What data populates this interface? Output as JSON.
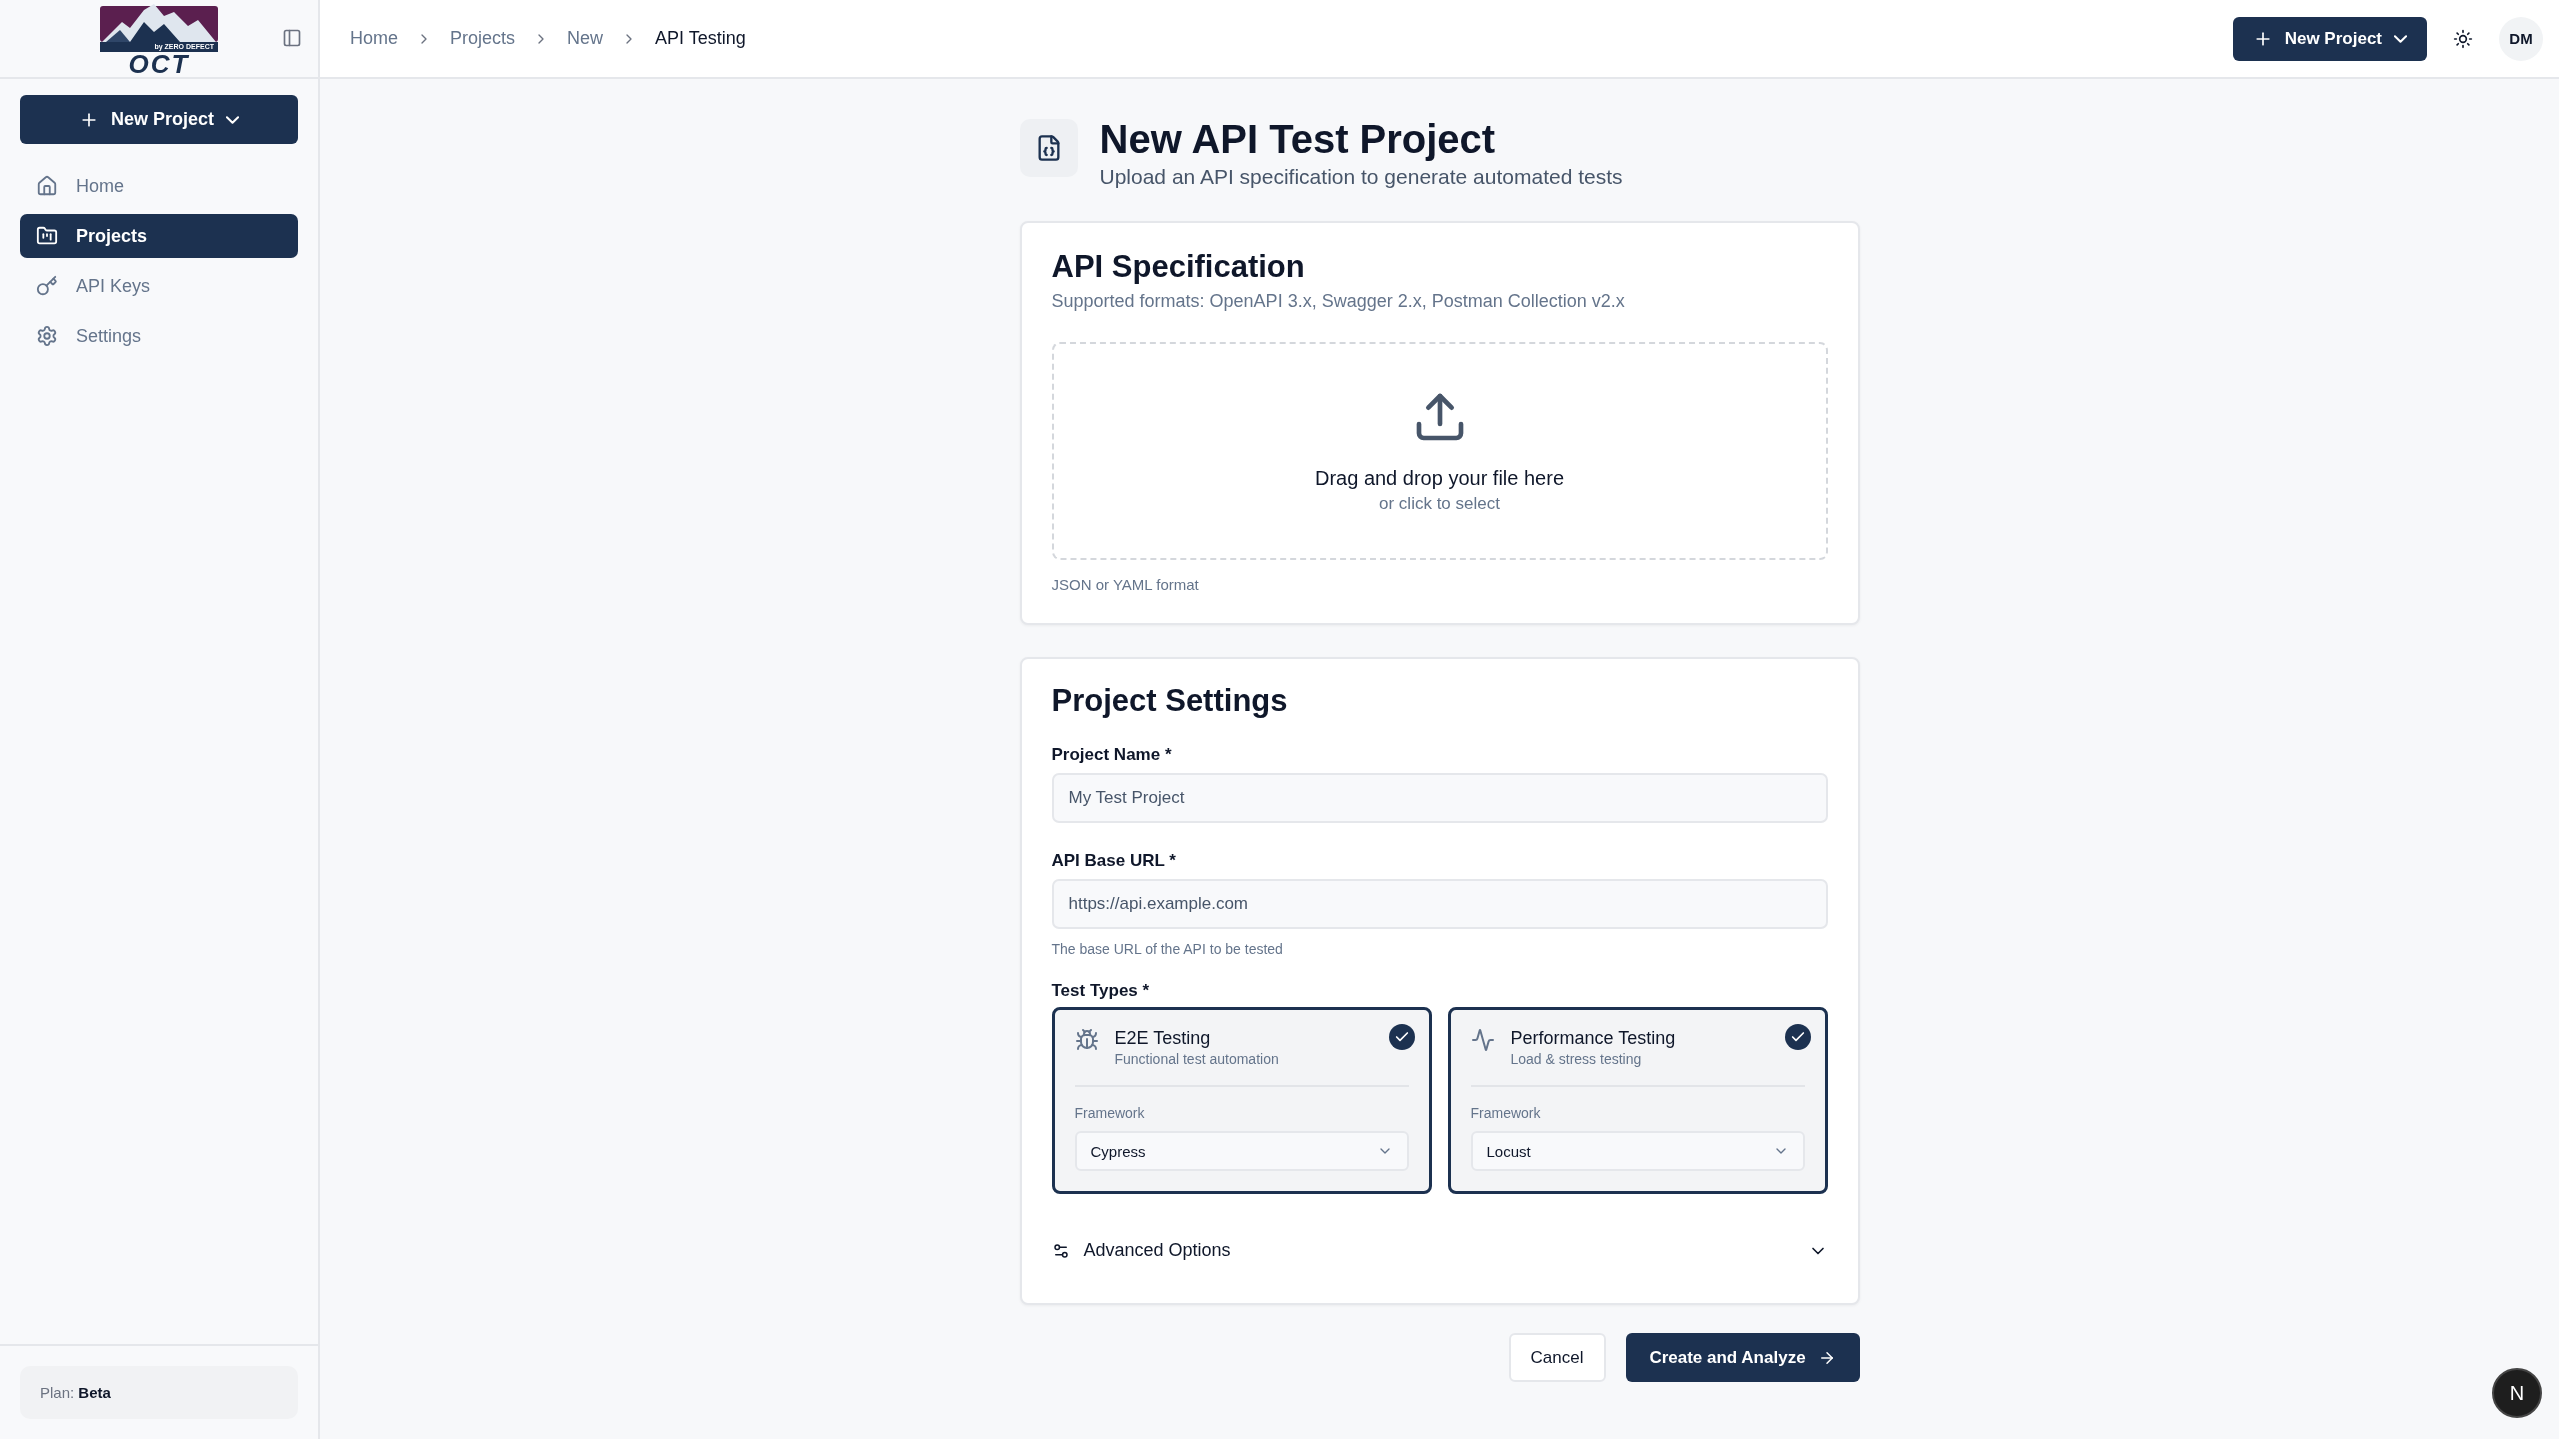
{
  "logo": {
    "tagline": "by ZERO DEFECT",
    "wordmark": "OCT"
  },
  "sidebar": {
    "new_project_button": "New Project",
    "items": [
      {
        "label": "Home",
        "selected": false
      },
      {
        "label": "Projects",
        "selected": true
      },
      {
        "label": "API Keys",
        "selected": false
      },
      {
        "label": "Settings",
        "selected": false
      }
    ],
    "plan": "Plan: **Beta**"
  },
  "breadcrumbs": [
    {
      "label": "Home",
      "current": false
    },
    {
      "label": "Projects",
      "current": false
    },
    {
      "label": "New",
      "current": false
    },
    {
      "label": "API Testing",
      "current": true
    }
  ],
  "header": {
    "new_project_button": "New Project",
    "avatar": "DM"
  },
  "page": {
    "title": "New API Test Project",
    "subtitle": "Upload an API specification to generate automated tests"
  },
  "api_spec": {
    "title": "API Specification",
    "formats": "Supported formats: OpenAPI 3.x, Swagger 2.x, Postman Collection v2.x",
    "dropzone": {
      "title": "Drag and drop your file here",
      "hint": "or click to select"
    },
    "note": "JSON or YAML format"
  },
  "settings": {
    "title": "Project Settings",
    "fields": [
      {
        "label": "Project Name *",
        "placeholder": "My Test Project"
      },
      {
        "label": "API Base URL *",
        "placeholder": "https://api.example.com",
        "help": "The base URL of the API to be tested"
      }
    ],
    "test_types_label": "Test Types *",
    "test_types": [
      {
        "kind": "e2e",
        "title": "E2E Testing",
        "subtitle": "Functional test automation",
        "selected": true,
        "framework_label": "Framework",
        "framework": "Cypress"
      },
      {
        "kind": "performance",
        "title": "Performance Testing",
        "subtitle": "Load & stress testing",
        "selected": true,
        "framework_label": "Framework",
        "framework": "Locust"
      }
    ],
    "advanced": {
      "label": "Advanced Options",
      "expanded": false
    }
  },
  "actions": {
    "cancel": "Cancel",
    "submit": "Create and Analyze"
  },
  "dev_badge": "N"
}
